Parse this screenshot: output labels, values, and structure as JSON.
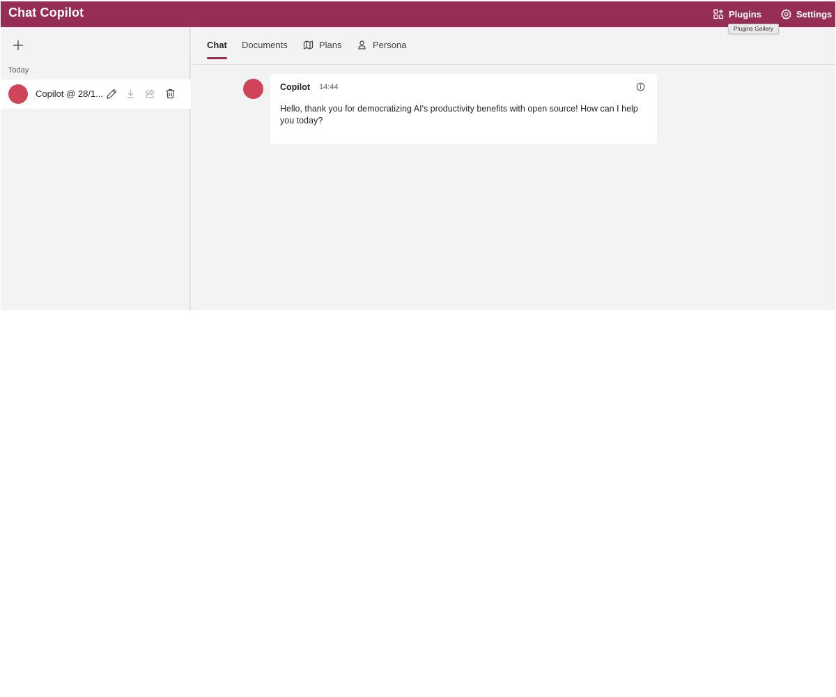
{
  "header": {
    "title": "Chat Copilot",
    "plugins_label": "Plugins",
    "settings_label": "Settings",
    "plugins_tooltip": "Plugins Gallery",
    "bg_color": "#962d54"
  },
  "sidebar": {
    "section_label": "Today",
    "conversations": [
      {
        "title": "Copilot @ 28/1...",
        "avatar_color": "#d04459"
      }
    ]
  },
  "tabs": [
    {
      "label": "Chat",
      "active": true
    },
    {
      "label": "Documents",
      "active": false,
      "icon": ""
    },
    {
      "label": "Plans",
      "active": false,
      "icon": "map-icon"
    },
    {
      "label": "Persona",
      "active": false,
      "icon": "person-icon"
    }
  ],
  "messages": [
    {
      "author": "Copilot",
      "time": "14:44",
      "text": "Hello, thank you for democratizing AI's productivity benefits with open source! How can I help you today?"
    }
  ],
  "colors": {
    "accent": "#962d54",
    "avatar": "#d04459"
  }
}
